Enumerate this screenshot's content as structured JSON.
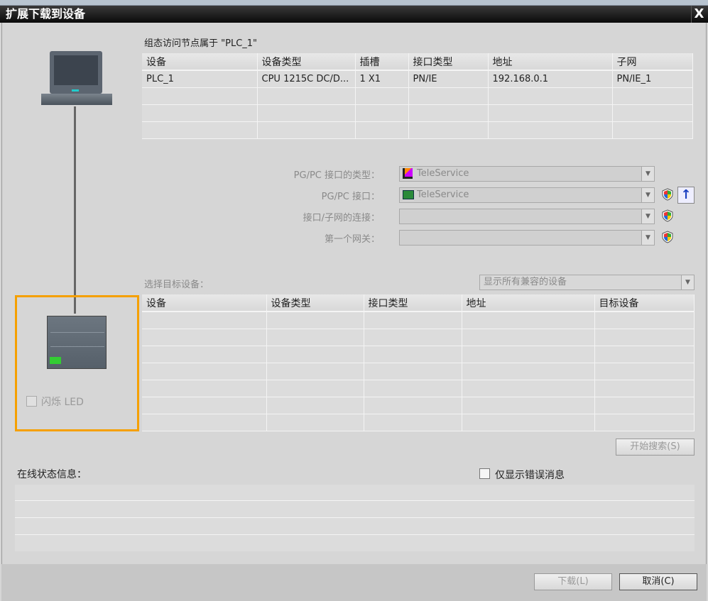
{
  "title": "扩展下载到设备",
  "close": "X",
  "config_heading": "组态访问节点属于 \"PLC_1\"",
  "config_table": {
    "headers": [
      "设备",
      "设备类型",
      "插槽",
      "接口类型",
      "地址",
      "子网"
    ],
    "rows": [
      [
        "PLC_1",
        "CPU 1215C DC/D...",
        "1 X1",
        "PN/IE",
        "192.168.0.1",
        "PN/IE_1"
      ],
      [
        "",
        "",
        "",
        "",
        "",
        ""
      ],
      [
        "",
        "",
        "",
        "",
        "",
        ""
      ],
      [
        "",
        "",
        "",
        "",
        "",
        ""
      ]
    ]
  },
  "fields": [
    {
      "label": "PG/PC 接口的类型：",
      "value": "TeleService",
      "icon": "teleservice-type-icon"
    },
    {
      "label": "PG/PC 接口：",
      "value": "TeleService",
      "icon": "network-card-icon"
    },
    {
      "label": "接口/子网的连接：",
      "value": ""
    },
    {
      "label": "第一个网关：",
      "value": ""
    }
  ],
  "select_target_label": "选择目标设备：",
  "filter_value": "显示所有兼容的设备",
  "target_table": {
    "headers": [
      "设备",
      "设备类型",
      "接口类型",
      "地址",
      "目标设备"
    ],
    "row_count": 7
  },
  "flash_led": "闪烁 LED",
  "search_button": "开始搜索(S)",
  "status_label": "在线状态信息：",
  "errors_only": "仅显示错误消息",
  "download_button": "下载(L)",
  "cancel_button": "取消(C)",
  "colors": {
    "highlight": "#f5a000"
  }
}
